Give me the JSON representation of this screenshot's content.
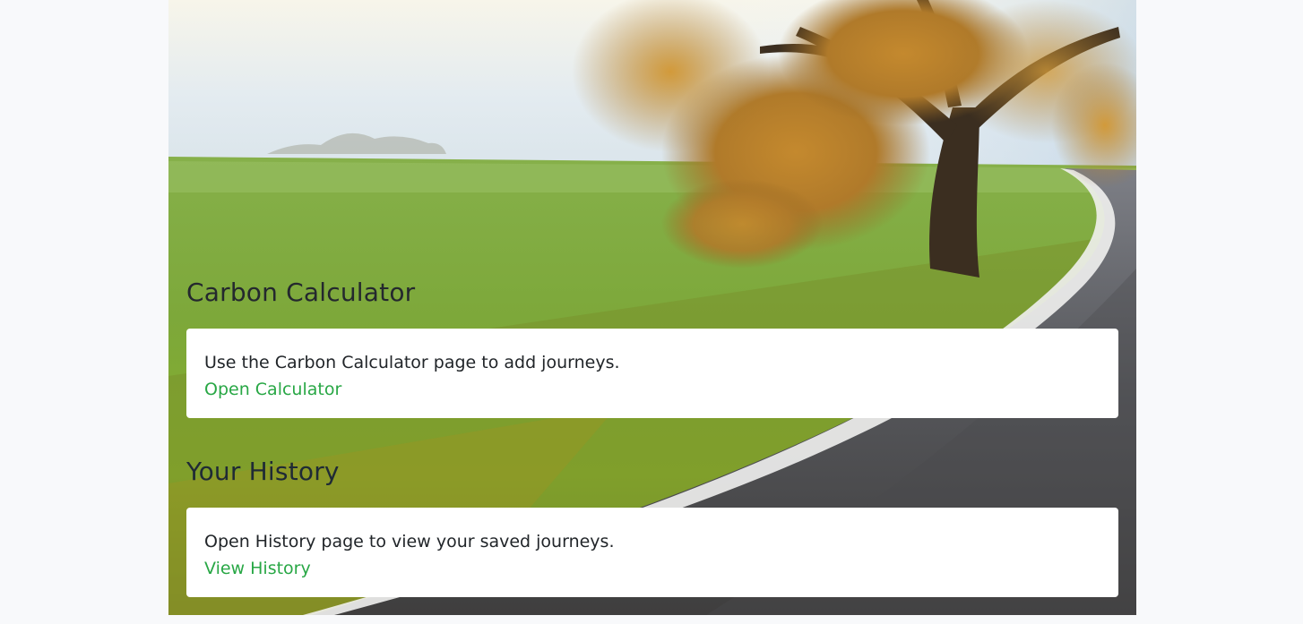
{
  "sections": {
    "calculator": {
      "title": "Carbon Calculator",
      "description": "Use the Carbon Calculator page to add journeys.",
      "link_label": "Open Calculator"
    },
    "history": {
      "title": "Your History",
      "description": "Open History page to view your saved journeys.",
      "link_label": "View History"
    }
  },
  "background": {
    "subject": "countryside road with autumn tree and green field"
  },
  "colors": {
    "page_background": "#f8f9fb",
    "link": "#28a745",
    "title_text": "#24282e",
    "card_background": "#ffffff"
  }
}
